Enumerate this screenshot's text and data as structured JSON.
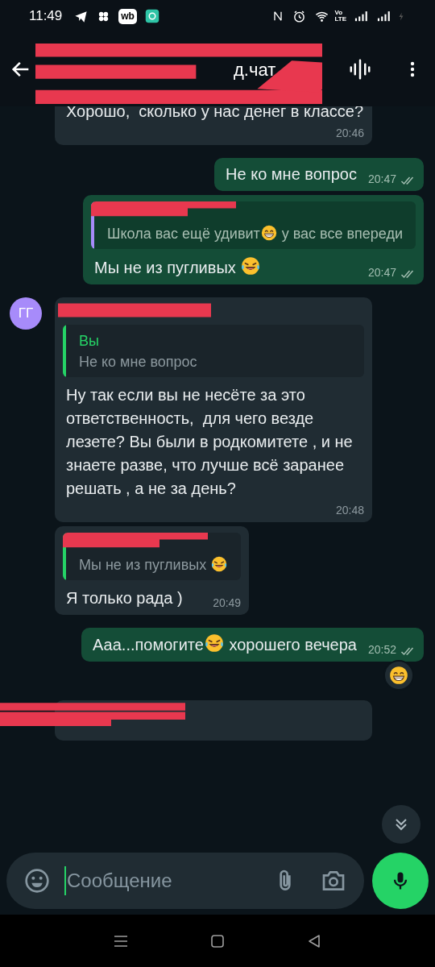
{
  "status_bar": {
    "time": "11:49",
    "app_badge": "wb",
    "network_label": [
      "Vo",
      "LTE"
    ]
  },
  "header": {
    "title": "д.чат",
    "title_redacted": true
  },
  "messages": [
    {
      "outgoing": false,
      "text": [
        {
          "kind": "text",
          "text": "Хорошо,  сколько у нас денег в классе?"
        }
      ],
      "time": "20:46"
    },
    {
      "outgoing": true,
      "text": [
        {
          "kind": "text",
          "text": "Не ко мне вопрос"
        }
      ],
      "time": "20:47",
      "read": false
    },
    {
      "outgoing": true,
      "quote": {
        "author_redacted": true,
        "color": "#a78bfa",
        "text": [
          {
            "kind": "text",
            "text": "Школа вас ещё удивит"
          },
          {
            "kind": "grin"
          },
          {
            "kind": "text",
            "text": " у вас все впереди"
          }
        ]
      },
      "text": [
        {
          "kind": "text",
          "text": "Мы не из пугливых "
        },
        {
          "kind": "laugh"
        }
      ],
      "time": "20:47",
      "read": false
    },
    {
      "outgoing": false,
      "avatar": {
        "initials": "ГГ",
        "color": "#a78bfa"
      },
      "sender_redacted": true,
      "quote": {
        "author": "Вы",
        "color": "#25d366",
        "text": [
          {
            "kind": "text",
            "text": "Не ко мне вопрос"
          }
        ]
      },
      "text": [
        {
          "kind": "text",
          "text": "Ну так если вы не несёте за это ответственность,  для чего везде лезете? Вы были в родкомитете , и не знаете разве, что лучше всё заранее решать , а не за день?"
        }
      ],
      "time": "20:48"
    },
    {
      "outgoing": false,
      "quote": {
        "author_redacted": true,
        "color": "#25d366",
        "text": [
          {
            "kind": "text",
            "text": "Мы не из пугливых "
          },
          {
            "kind": "laugh"
          }
        ]
      },
      "text": [
        {
          "kind": "text",
          "text": "Я только рада )"
        }
      ],
      "time": "20:49"
    },
    {
      "outgoing": true,
      "text": [
        {
          "kind": "text",
          "text": "Ааа...помогите"
        },
        {
          "kind": "laugh"
        },
        {
          "kind": "text",
          "text": " хорошего вечера"
        }
      ],
      "time": "20:52",
      "read": false,
      "reaction": {
        "kind": "grin"
      }
    },
    {
      "outgoing": false,
      "sender_redacted": true,
      "partial": true
    }
  ],
  "composer": {
    "placeholder": "Сообщение"
  }
}
